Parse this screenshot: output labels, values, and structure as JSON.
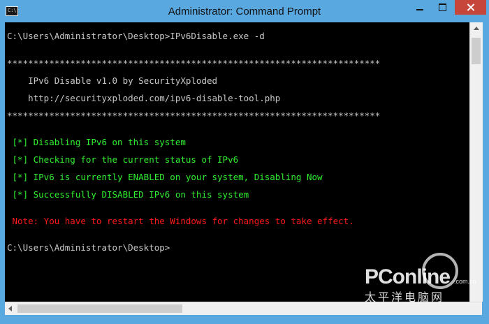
{
  "window": {
    "title": "Administrator: Command Prompt",
    "icon_label": "C:\\",
    "icon": "cmd-icon"
  },
  "console": {
    "lines": [
      {
        "text": "C:\\Users\\Administrator\\Desktop>IPv6Disable.exe -d",
        "color": "white"
      },
      {
        "text": "***********************************************************************",
        "color": "white"
      },
      {
        "text": "    IPv6 Disable v1.0 by SecurityXploded",
        "color": "white"
      },
      {
        "text": "    http://securityxploded.com/ipv6-disable-tool.php",
        "color": "white"
      },
      {
        "text": "***********************************************************************",
        "color": "white"
      },
      {
        "text": " [*] Disabling IPv6 on this system",
        "color": "green"
      },
      {
        "text": " [*] Checking for the current status of IPv6",
        "color": "green"
      },
      {
        "text": " [*] IPv6 is currently ENABLED on your system, Disabling Now",
        "color": "green"
      },
      {
        "text": " [*] Successfully DISABLED IPv6 on this system",
        "color": "green"
      },
      {
        "text": " Note: You have to restart the Windows for changes to take effect.",
        "color": "red"
      },
      {
        "text": "C:\\Users\\Administrator\\Desktop>",
        "color": "white"
      }
    ]
  },
  "watermark": {
    "logo": "PConline",
    "domain": ".com.cn",
    "chinese": "太平洋电脑网"
  },
  "colors": {
    "titlebar": "#5aa8e0",
    "console_bg": "#000000",
    "text_white": "#c8c8c8",
    "text_green": "#2ff02f",
    "text_red": "#ff1a1a",
    "close_button": "#c7463c"
  }
}
